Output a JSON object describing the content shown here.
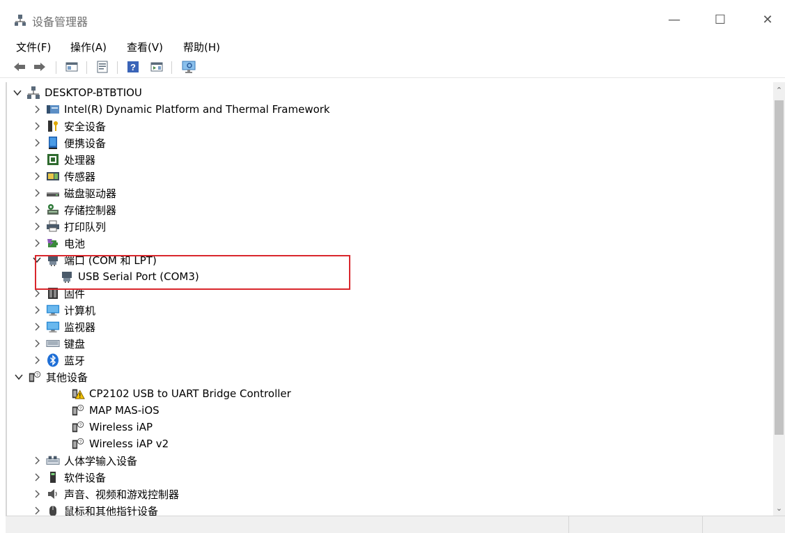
{
  "window": {
    "title": "设备管理器",
    "min_glyph": "—",
    "max_glyph": "☐",
    "close_glyph": "✕"
  },
  "menu": {
    "items": [
      "文件(F)",
      "操作(A)",
      "查看(V)",
      "帮助(H)"
    ]
  },
  "toolbar": {
    "buttons": [
      "back-icon",
      "forward-icon",
      "show-hide-tree-icon",
      "properties-icon",
      "help-icon",
      "action-pane-icon",
      "scan-hardware-icon"
    ]
  },
  "tree": {
    "root": {
      "label": "DESKTOP-BTBTIOU",
      "icon": "computer-network-icon",
      "expanded": true
    },
    "nodes": [
      {
        "label": "Intel(R) Dynamic Platform and Thermal Framework",
        "icon": "platform-icon",
        "expanded": false
      },
      {
        "label": "安全设备",
        "icon": "security-key-icon",
        "expanded": false
      },
      {
        "label": "便携设备",
        "icon": "portable-device-icon",
        "expanded": false
      },
      {
        "label": "处理器",
        "icon": "processor-icon",
        "expanded": false
      },
      {
        "label": "传感器",
        "icon": "sensor-icon",
        "expanded": false
      },
      {
        "label": "磁盘驱动器",
        "icon": "disk-drive-icon",
        "expanded": false
      },
      {
        "label": "存储控制器",
        "icon": "storage-controller-icon",
        "expanded": false
      },
      {
        "label": "打印队列",
        "icon": "printer-icon",
        "expanded": false
      },
      {
        "label": "电池",
        "icon": "battery-icon",
        "expanded": false
      },
      {
        "label": "端口 (COM 和 LPT)",
        "icon": "port-icon",
        "expanded": true,
        "children": [
          {
            "label": "USB Serial Port (COM3)",
            "icon": "port-icon"
          }
        ]
      },
      {
        "label": "固件",
        "icon": "firmware-icon",
        "expanded": false
      },
      {
        "label": "计算机",
        "icon": "computer-icon",
        "expanded": false
      },
      {
        "label": "监视器",
        "icon": "monitor-icon",
        "expanded": false
      },
      {
        "label": "键盘",
        "icon": "keyboard-icon",
        "expanded": false
      },
      {
        "label": "蓝牙",
        "icon": "bluetooth-icon",
        "expanded": false
      },
      {
        "label": "其他设备",
        "icon": "unknown-device-icon",
        "expanded": true,
        "children": [
          {
            "label": "CP2102 USB to UART Bridge Controller",
            "icon": "warning-device-icon"
          },
          {
            "label": "MAP MAS-iOS",
            "icon": "unknown-device-icon"
          },
          {
            "label": "Wireless iAP",
            "icon": "unknown-device-icon"
          },
          {
            "label": "Wireless iAP v2",
            "icon": "unknown-device-icon"
          }
        ]
      },
      {
        "label": "人体学输入设备",
        "icon": "hid-icon",
        "expanded": false
      },
      {
        "label": "软件设备",
        "icon": "software-device-icon",
        "expanded": false
      },
      {
        "label": "声音、视频和游戏控制器",
        "icon": "audio-icon",
        "expanded": false
      },
      {
        "label": "鼠标和其他指针设备",
        "icon": "mouse-icon",
        "expanded": false
      }
    ]
  },
  "colors": {
    "highlight_border": "#d9262c",
    "monitor_blue": "#2a8ad4",
    "bluetooth_blue": "#1f6fd6",
    "warning_yellow": "#f2c200"
  }
}
